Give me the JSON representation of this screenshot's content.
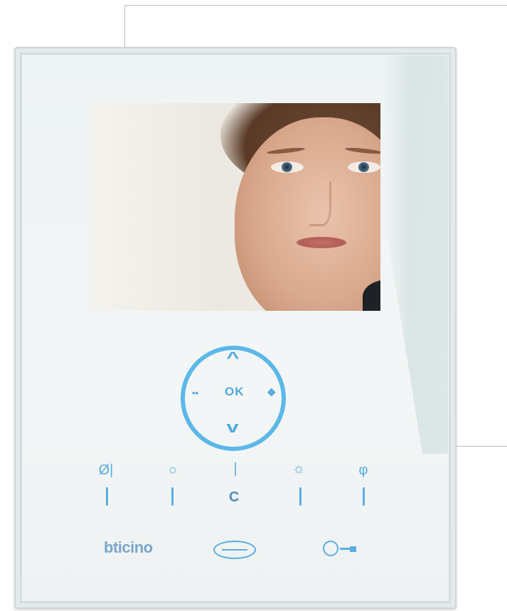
{
  "device": {
    "brand": "bticino"
  },
  "screen": {
    "content": "video-call-face"
  },
  "navigation": {
    "up_glyph": "^",
    "down_glyph": "v",
    "left_glyph": "••",
    "right_glyph": "❖",
    "ok_label": "OK"
  },
  "function_keys": [
    {
      "icon": "mute-icon",
      "glyph": "Ø|"
    },
    {
      "icon": "circle-icon",
      "glyph": "○"
    },
    {
      "icon": "bar-icon",
      "glyph": "|"
    },
    {
      "icon": "light-icon",
      "glyph": "☼"
    },
    {
      "icon": "tap-icon",
      "glyph": "φ"
    }
  ],
  "center_key_label": "C",
  "colors": {
    "accent": "#5aaee0",
    "brand": "#7aa6c9"
  }
}
